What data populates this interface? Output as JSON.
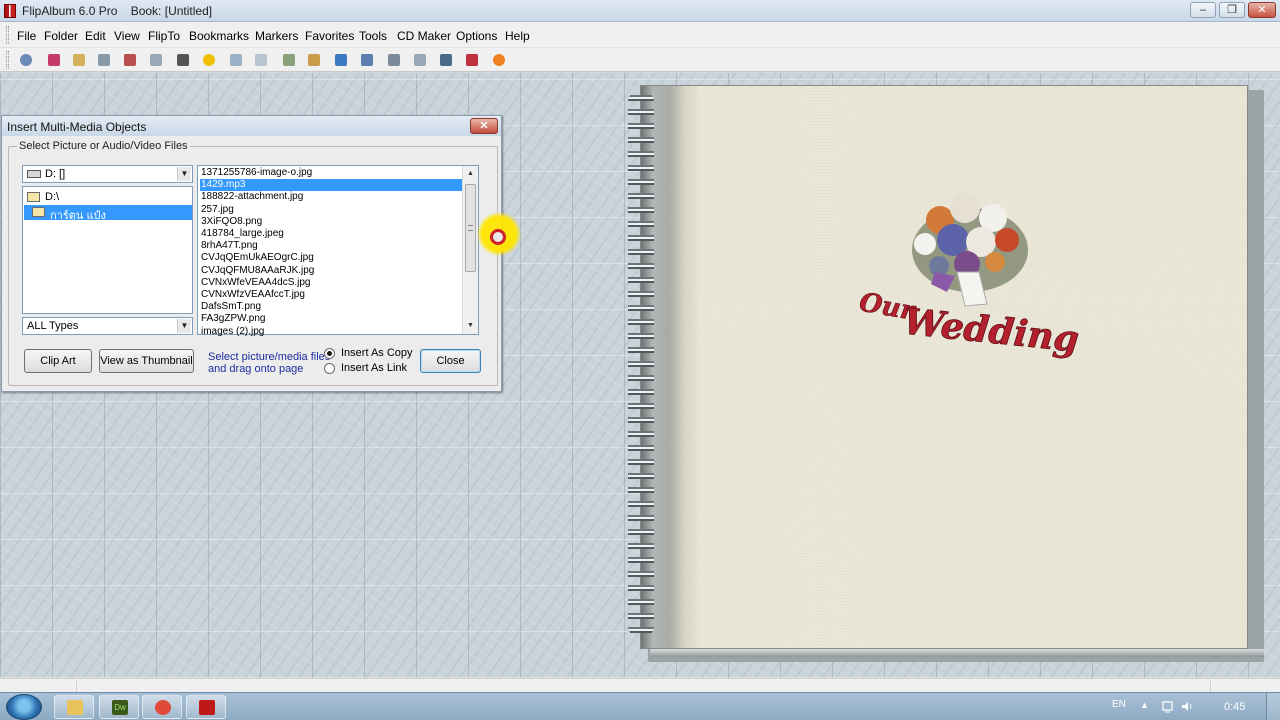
{
  "window": {
    "title": "FlipAlbum 6.0 Pro    Book: [Untitled]",
    "min_label": "‒",
    "max_label": "❐",
    "close_label": "✕"
  },
  "menu": {
    "items": [
      "File",
      "Folder",
      "Edit",
      "View",
      "FlipTo",
      "Bookmarks",
      "Markers",
      "Favorites",
      "Tools",
      "CD Maker",
      "Options",
      "Help"
    ]
  },
  "toolbar": {
    "icons": [
      "eye-icon",
      "bookmark-icon",
      "open-book-icon",
      "page-icon",
      "next-page-icon",
      "pages-icon",
      "print-icon",
      "add-icon",
      "edit-icon",
      "two-pages-icon",
      "tools-icon",
      "book-icon",
      "web-icon",
      "sheet-icon",
      "film-icon",
      "slides-icon",
      "gallery-icon",
      "arrow-icon",
      "burn-icon"
    ],
    "colors": [
      "#6c8ab6",
      "#c43b6a",
      "#d5b15c",
      "#8a9aa8",
      "#b85050",
      "#9aa8b8",
      "#555",
      "#f0c000",
      "#9ab0c6",
      "#b8c4d0",
      "#8aa07a",
      "#c99c4a",
      "#3a7ac0",
      "#5a7fb0",
      "#7a8a9a",
      "#9aa8b8",
      "#4a6a8a",
      "#c03040",
      "#f08020"
    ]
  },
  "dialog": {
    "title": "Insert Multi-Media Objects",
    "close_label": "✕",
    "group_label": "Select Picture or Audio/Video Files",
    "drive_value": "D: []",
    "folders": [
      {
        "label": "D:\\",
        "selected": false
      },
      {
        "label": "การ์ตูน แป๋ง",
        "selected": true
      }
    ],
    "type_value": "ALL Types",
    "files": [
      {
        "name": "1371255786-image-o.jpg",
        "selected": false
      },
      {
        "name": "1429.mp3",
        "selected": true
      },
      {
        "name": "188822-attachment.jpg",
        "selected": false
      },
      {
        "name": "257.jpg",
        "selected": false
      },
      {
        "name": "3XiFQO8.png",
        "selected": false
      },
      {
        "name": "418784_large.jpeg",
        "selected": false
      },
      {
        "name": "8rhA47T.png",
        "selected": false
      },
      {
        "name": "CVJqQEmUkAEOgrC.jpg",
        "selected": false
      },
      {
        "name": "CVJqQFMU8AAaRJK.jpg",
        "selected": false
      },
      {
        "name": "CVNxWfeVEAA4dcS.jpg",
        "selected": false
      },
      {
        "name": "CVNxWfzVEAAfccT.jpg",
        "selected": false
      },
      {
        "name": "DafsSmT.png",
        "selected": false
      },
      {
        "name": "FA3gZPW.png",
        "selected": false
      },
      {
        "name": "images (2).jpg",
        "selected": false
      }
    ],
    "scroll_up": "▲",
    "scroll_down": "▼",
    "combo_arrow": "▼",
    "clip_art_label": "Clip Art",
    "thumbnail_label": "View as Thumbnail",
    "hint_line1": "Select picture/media files",
    "hint_line2": "and drag onto page",
    "radio_copy": "Insert As Copy",
    "radio_link": "Insert As Link",
    "radio_selected": "copy",
    "close_button": "Close"
  },
  "album": {
    "title_small": "Our",
    "title_large": "Wedding",
    "title_color": "#b5202e"
  },
  "taskbar": {
    "apps": [
      {
        "name": "explorer-icon",
        "color": "#e8c25a",
        "text": ""
      },
      {
        "name": "dreamweaver-icon",
        "color": "#3c5a1c",
        "text": "Dw"
      },
      {
        "name": "chrome-icon",
        "color": "#e04a3a",
        "text": ""
      },
      {
        "name": "flipalbum-icon",
        "color": "#c01818",
        "text": ""
      }
    ],
    "lang": "EN",
    "tray_arrow": "▲",
    "clock": "0:45"
  }
}
